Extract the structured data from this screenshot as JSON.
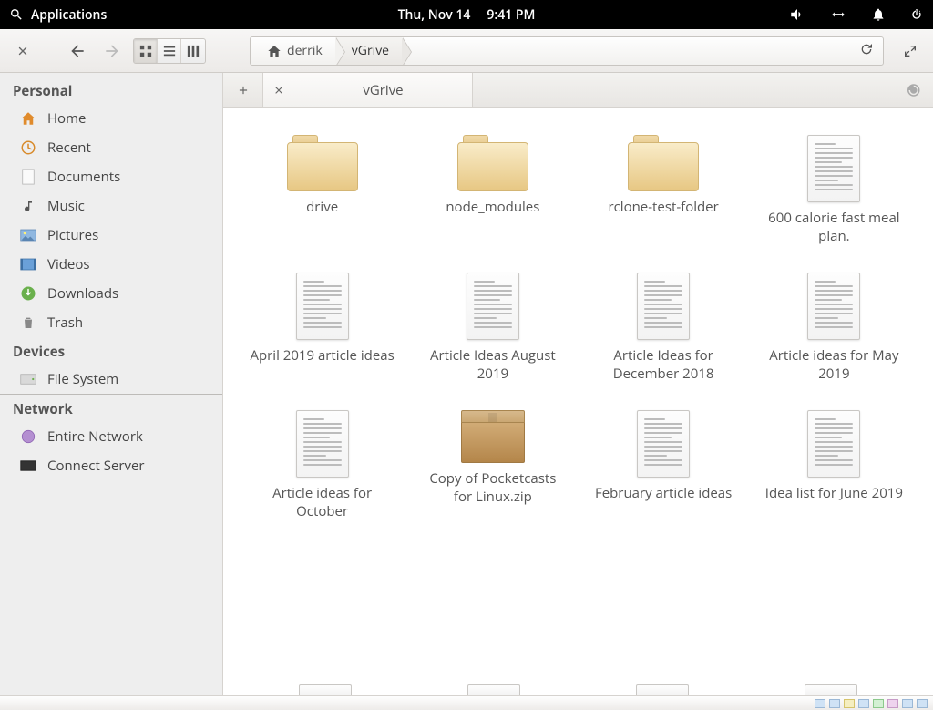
{
  "panel": {
    "apps_label": "Applications",
    "date": "Thu, Nov 14",
    "time": "9:41 PM"
  },
  "toolbar": {
    "breadcrumbs": [
      "derrik",
      "vGrive"
    ]
  },
  "sidebar": {
    "sections": {
      "personal": {
        "title": "Personal",
        "items": [
          "Home",
          "Recent",
          "Documents",
          "Music",
          "Pictures",
          "Videos",
          "Downloads",
          "Trash"
        ]
      },
      "devices": {
        "title": "Devices",
        "items": [
          "File System"
        ]
      },
      "network": {
        "title": "Network",
        "items": [
          "Entire Network",
          "Connect Server"
        ]
      }
    }
  },
  "tabs": {
    "new_hint": "+",
    "active": {
      "title": "vGrive"
    }
  },
  "files": [
    {
      "name": "drive",
      "kind": "folder"
    },
    {
      "name": "node_modules",
      "kind": "folder"
    },
    {
      "name": "rclone-test-folder",
      "kind": "folder"
    },
    {
      "name": "600 calorie fast meal plan.",
      "kind": "doc"
    },
    {
      "name": "April 2019 article ideas",
      "kind": "doc"
    },
    {
      "name": "Article Ideas August 2019",
      "kind": "doc"
    },
    {
      "name": "Article Ideas for December 2018",
      "kind": "doc"
    },
    {
      "name": "Article ideas for May 2019",
      "kind": "doc"
    },
    {
      "name": "Article ideas for October",
      "kind": "doc"
    },
    {
      "name": "Copy of Pocketcasts for Linux.zip",
      "kind": "archive"
    },
    {
      "name": "February article ideas",
      "kind": "doc"
    },
    {
      "name": "Idea list for June 2019",
      "kind": "doc"
    }
  ]
}
